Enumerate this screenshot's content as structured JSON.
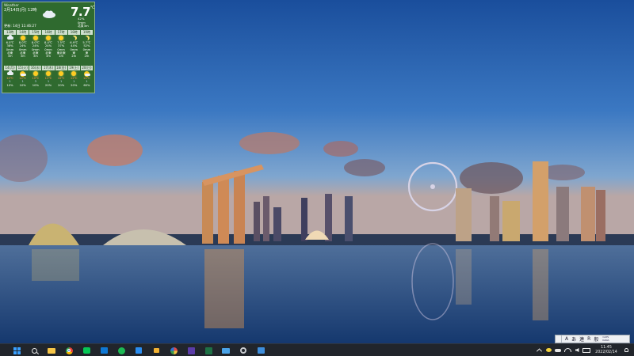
{
  "weather": {
    "title": "Weather",
    "date": "2月14日(月) 12時",
    "temperature": "7.7",
    "unit": "℃",
    "details": [
      "42%",
      "0mm",
      "北東3m"
    ],
    "updated": "更新: 14日 11:46:27",
    "hourly": [
      {
        "time": "13時",
        "icon": "cloud-icon",
        "temp": "6.5℃",
        "pct": "38%",
        "rain": "0mm",
        "wind": "北東",
        "speed": "3m"
      },
      {
        "time": "14時",
        "icon": "sun-icon",
        "temp": "8.0℃",
        "pct": "24%",
        "rain": "0mm",
        "wind": "北東",
        "speed": "3m"
      },
      {
        "time": "15時",
        "icon": "sun-icon",
        "temp": "8.0℃",
        "pct": "24%",
        "rain": "0mm",
        "wind": "北東",
        "speed": "3m"
      },
      {
        "time": "16時",
        "icon": "sun-icon",
        "temp": "8.4℃",
        "pct": "24%",
        "rain": "0mm",
        "wind": "北東",
        "speed": "3m"
      },
      {
        "time": "17時",
        "icon": "sun-icon",
        "temp": "7.5℃",
        "pct": "37%",
        "rain": "0mm",
        "wind": "東北東",
        "speed": "1m"
      },
      {
        "time": "18時",
        "icon": "moon-icon",
        "temp": "6.9℃",
        "pct": "44%",
        "rain": "0mm",
        "wind": "東",
        "speed": "2m"
      },
      {
        "time": "19時",
        "icon": "moon-icon",
        "temp": "5.7℃",
        "pct": "52%",
        "rain": "0mm",
        "wind": "東",
        "speed": "2m"
      }
    ],
    "daily": [
      {
        "day": "14(月)",
        "icon": "cloud-icon",
        "hi": "10℃",
        "lo": "1",
        "pop": "10%"
      },
      {
        "day": "15(火)",
        "icon": "sun-cloud-icon",
        "hi": "12℃",
        "lo": "1",
        "pop": "10%"
      },
      {
        "day": "16(水)",
        "icon": "sun-icon",
        "hi": "10℃",
        "lo": "3",
        "pop": "10%"
      },
      {
        "day": "17(木)",
        "icon": "sun-icon",
        "hi": "11℃",
        "lo": "1",
        "pop": "20%"
      },
      {
        "day": "18(金)",
        "icon": "sun-icon",
        "hi": "10℃",
        "lo": "1",
        "pop": "20%"
      },
      {
        "day": "19(土)",
        "icon": "sun-icon",
        "hi": "12℃",
        "lo": "1",
        "pop": "20%"
      },
      {
        "day": "20(日)",
        "icon": "sun-cloud-icon",
        "hi": "10℃",
        "lo": "1",
        "pop": "60%"
      }
    ]
  },
  "taskbar": {
    "apps": [
      "start-icon",
      "search-icon",
      "file-explorer-icon",
      "chrome-icon",
      "line-icon",
      "store-icon",
      "spotify-icon",
      "calendar-icon",
      "lock-icon",
      "paint-icon",
      "sv-icon",
      "excel-icon",
      "mail-icon",
      "settings-icon",
      "photos-icon"
    ],
    "clock_time": "11:45",
    "clock_date": "2022/02/14"
  },
  "ime": {
    "mode_a": "A",
    "items": [
      "あ",
      "連",
      "R",
      "般"
    ],
    "caps": "CAPS",
    "kana": "KANA"
  },
  "colors": {
    "widget_bg": "#2f6a2f",
    "taskbar_bg": "#21252b",
    "accent_blue": "#3aa0ff"
  }
}
